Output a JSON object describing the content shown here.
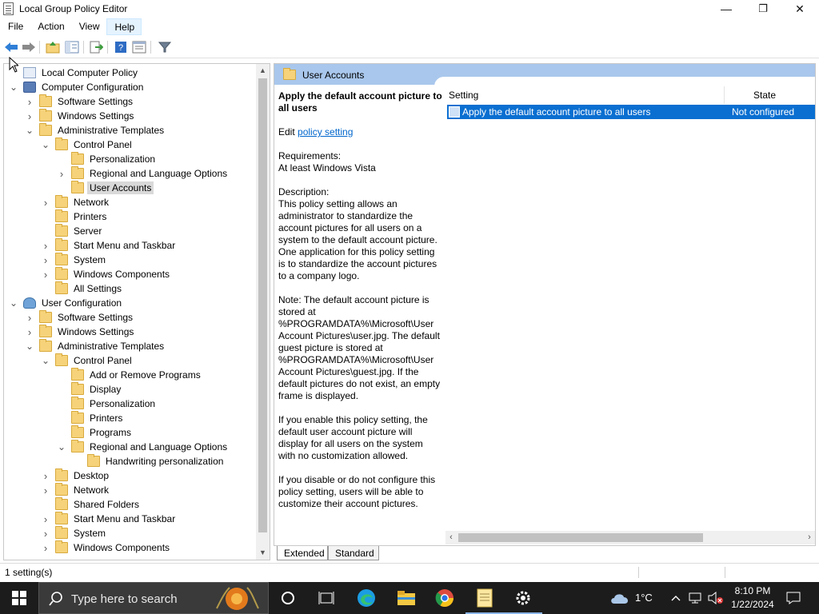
{
  "window": {
    "title": "Local Group Policy Editor",
    "minimize": "—",
    "maximize": "❐",
    "close": "✕"
  },
  "menu": [
    "File",
    "Action",
    "View",
    "Help"
  ],
  "tree": {
    "items": [
      {
        "label": "Local Computer Policy",
        "level": 0,
        "icon": "policy",
        "exp": ""
      },
      {
        "label": "Computer Configuration",
        "level": 1,
        "icon": "computer",
        "exp": "v"
      },
      {
        "label": "Software Settings",
        "level": 2,
        "icon": "folder",
        "exp": ">"
      },
      {
        "label": "Windows Settings",
        "level": 2,
        "icon": "folder",
        "exp": ">"
      },
      {
        "label": "Administrative Templates",
        "level": 2,
        "icon": "folder",
        "exp": "v"
      },
      {
        "label": "Control Panel",
        "level": 3,
        "icon": "folder",
        "exp": "v"
      },
      {
        "label": "Personalization",
        "level": 4,
        "icon": "folder",
        "exp": ""
      },
      {
        "label": "Regional and Language Options",
        "level": 4,
        "icon": "folder",
        "exp": ">"
      },
      {
        "label": "User Accounts",
        "level": 4,
        "icon": "folder",
        "exp": "",
        "selected": true
      },
      {
        "label": "Network",
        "level": 3,
        "icon": "folder",
        "exp": ">"
      },
      {
        "label": "Printers",
        "level": 3,
        "icon": "folder",
        "exp": ""
      },
      {
        "label": "Server",
        "level": 3,
        "icon": "folder",
        "exp": ""
      },
      {
        "label": "Start Menu and Taskbar",
        "level": 3,
        "icon": "folder",
        "exp": ">"
      },
      {
        "label": "System",
        "level": 3,
        "icon": "folder",
        "exp": ">"
      },
      {
        "label": "Windows Components",
        "level": 3,
        "icon": "folder",
        "exp": ">"
      },
      {
        "label": "All Settings",
        "level": 3,
        "icon": "folder",
        "exp": ""
      },
      {
        "label": "User Configuration",
        "level": 1,
        "icon": "user",
        "exp": "v"
      },
      {
        "label": "Software Settings",
        "level": 2,
        "icon": "folder",
        "exp": ">"
      },
      {
        "label": "Windows Settings",
        "level": 2,
        "icon": "folder",
        "exp": ">"
      },
      {
        "label": "Administrative Templates",
        "level": 2,
        "icon": "folder",
        "exp": "v"
      },
      {
        "label": "Control Panel",
        "level": 3,
        "icon": "folder",
        "exp": "v"
      },
      {
        "label": "Add or Remove Programs",
        "level": 4,
        "icon": "folder",
        "exp": ""
      },
      {
        "label": "Display",
        "level": 4,
        "icon": "folder",
        "exp": ""
      },
      {
        "label": "Personalization",
        "level": 4,
        "icon": "folder",
        "exp": ""
      },
      {
        "label": "Printers",
        "level": 4,
        "icon": "folder",
        "exp": ""
      },
      {
        "label": "Programs",
        "level": 4,
        "icon": "folder",
        "exp": ""
      },
      {
        "label": "Regional and Language Options",
        "level": 4,
        "icon": "folder",
        "exp": "v"
      },
      {
        "label": "Handwriting personalization",
        "level": 5,
        "icon": "folder",
        "exp": ""
      },
      {
        "label": "Desktop",
        "level": 3,
        "icon": "folder",
        "exp": ">"
      },
      {
        "label": "Network",
        "level": 3,
        "icon": "folder",
        "exp": ">"
      },
      {
        "label": "Shared Folders",
        "level": 3,
        "icon": "folder",
        "exp": ""
      },
      {
        "label": "Start Menu and Taskbar",
        "level": 3,
        "icon": "folder",
        "exp": ">"
      },
      {
        "label": "System",
        "level": 3,
        "icon": "folder",
        "exp": ">"
      },
      {
        "label": "Windows Components",
        "level": 3,
        "icon": "folder",
        "exp": ">"
      }
    ]
  },
  "right": {
    "header": "User Accounts",
    "policy_title": "Apply the default account picture to all users",
    "edit_prefix": "Edit ",
    "edit_link": "policy setting ",
    "requirements": "Requirements:\nAt least Windows Vista",
    "description": "Description:\nThis policy setting allows an administrator to standardize the account pictures for all users on a system to the default account picture. One application for this policy setting is to standardize the account pictures to a company logo.",
    "note": "Note: The default account picture is stored at %PROGRAMDATA%\\Microsoft\\User Account Pictures\\user.jpg. The default guest picture is stored at %PROGRAMDATA%\\Microsoft\\User Account Pictures\\guest.jpg. If the default pictures do not exist, an empty frame is displayed.",
    "enable": "If you enable this policy setting, the default user account picture will display for all users on the system with no customization allowed.",
    "disable": "If you disable or do not configure this policy setting, users will be able to customize their account pictures.",
    "col_setting": "Setting",
    "col_state": "State",
    "row_setting": "Apply the default account picture to all users",
    "row_state": "Not configured"
  },
  "tabs": [
    "Extended",
    "Standard"
  ],
  "status": "1 setting(s)",
  "taskbar": {
    "search_placeholder": "Type here to search",
    "weather": "1°C",
    "time": "8:10 PM",
    "date": "1/22/2024"
  }
}
